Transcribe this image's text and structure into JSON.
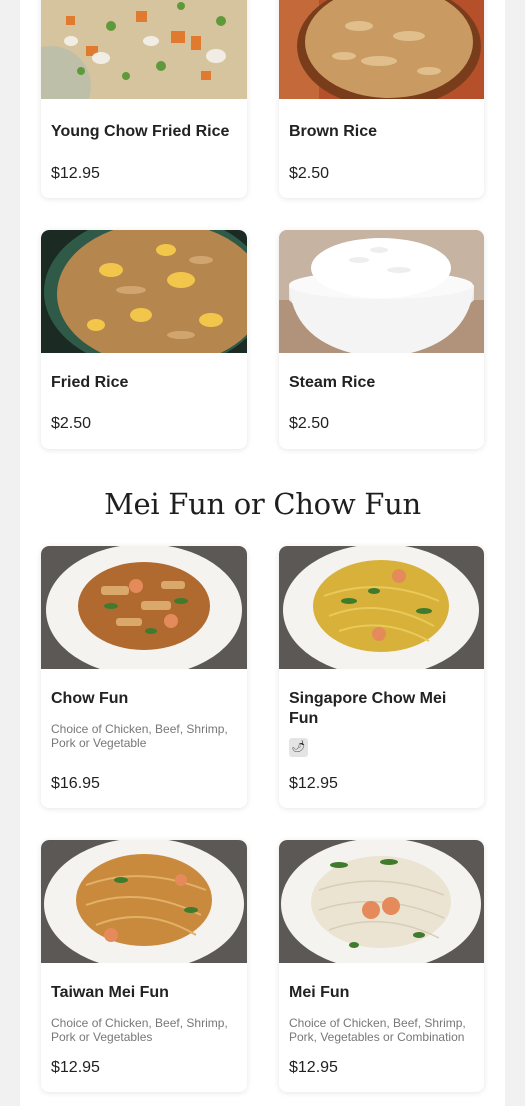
{
  "sections": {
    "rice_tail": {
      "items": [
        {
          "name": "Young Chow Fried Rice",
          "price": "$12.95"
        },
        {
          "name": "Brown Rice",
          "price": "$2.50"
        },
        {
          "name": "Fried Rice",
          "price": "$2.50"
        },
        {
          "name": "Steam Rice",
          "price": "$2.50"
        }
      ]
    },
    "mei_fun": {
      "title": "Mei Fun or Chow Fun",
      "items": [
        {
          "name": "Chow Fun",
          "description": "Choice of Chicken, Beef, Shrimp, Pork or Vegetable",
          "price": "$16.95"
        },
        {
          "name": "Singapore Chow Mei Fun",
          "badge": "🌶",
          "price": "$12.95"
        },
        {
          "name": "Taiwan Mei Fun",
          "description": "Choice of Chicken, Beef, Shrimp, Pork or Vegetables",
          "price": "$12.95"
        },
        {
          "name": "Mei Fun",
          "description": "Choice of Chicken, Beef, Shrimp, Pork, Vegetables or Combination",
          "price": "$12.95"
        }
      ]
    }
  },
  "colors": {
    "page_bg": "#f1f1f1",
    "card_bg": "#ffffff",
    "text": "#222222",
    "muted": "#777777"
  }
}
